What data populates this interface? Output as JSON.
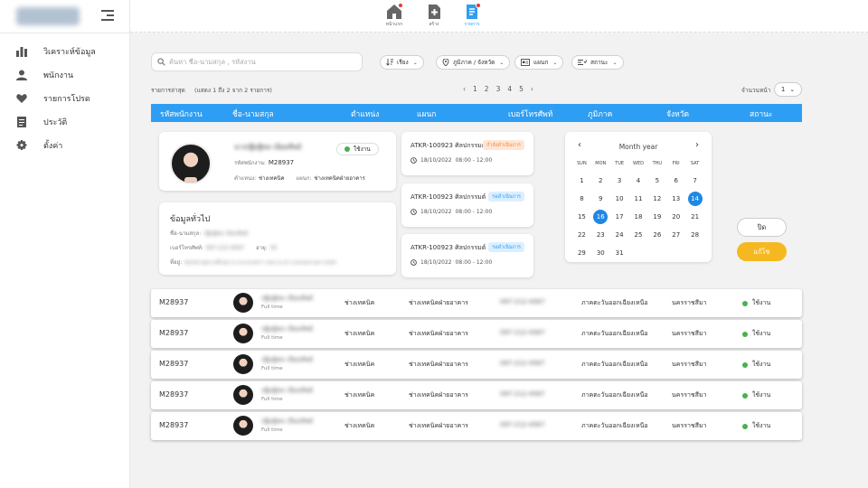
{
  "sidebar": {
    "items": [
      {
        "label": "วิเคราะห์ข้อมูล",
        "icon": "bar-chart-icon"
      },
      {
        "label": "พนักงาน",
        "icon": "person-icon"
      },
      {
        "label": "รายการโปรด",
        "icon": "heart-icon"
      },
      {
        "label": "ประวัติ",
        "icon": "document-icon"
      },
      {
        "label": "ตั้งค่า",
        "icon": "gear-icon"
      }
    ]
  },
  "topnav": {
    "items": [
      {
        "label": "หน้าแรก",
        "icon": "home-icon",
        "has_notification": true
      },
      {
        "label": "สร้าง",
        "icon": "add-document-icon",
        "has_notification": false
      },
      {
        "label": "รายการ",
        "icon": "list-document-icon",
        "has_notification": true,
        "active": true
      }
    ]
  },
  "search": {
    "placeholder": "ค้นหา ชื่อ-นามสกุล , รหัสงาน"
  },
  "filters": [
    "เรียง",
    "ภูมิภาค / จังหวัด",
    "แผนก",
    "สถานะ"
  ],
  "list": {
    "title": "รายการล่าสุด",
    "range": "(แสดง 1 ถึง 2 จาก 2 รายการ)",
    "pages": [
      "1",
      "2",
      "3",
      "4",
      "5"
    ],
    "per_page_label": "จำนวนหน้า",
    "per_page_value": "1"
  },
  "table_headers": [
    "รหัสพนักงาน",
    "ชื่อ-นามสกุล",
    "ตำแหน่ง",
    "แผนก",
    "เบอร์โทรศัพท์",
    "ภูมิภาค",
    "จังหวัด",
    "สถานะ"
  ],
  "detail": {
    "name": "นางปฐิมฐิพล เนียมทิพย์",
    "status": "ใช้งาน",
    "emp_id_label": "รหัสพนักงาน:",
    "emp_id": "M28937",
    "position_label": "ตำแหน่ง:",
    "position": "ช่างเทคนิค",
    "dept_label": "แผนก:",
    "dept": "ช่างเทคนิคฝ่ายอาคาร",
    "general_title": "ข้อมูลทั่วไป",
    "fullname_label": "ชื่อ-นามสกุล:",
    "fullname": "ปฐิมฐิพล เนียมทิพย์",
    "phone_label": "เบอร์โทรศัพท์:",
    "phone": "097-212-4567",
    "age_label": "อายุ:",
    "age": "34",
    "address_label": "ที่อยู่:",
    "address": "883/98 หมู่บ้าน ซิตี้ ซอย 12 แขวงลาดพร้าว เขตบางกะปิ จ.กรุงเทพมหานคร 10900",
    "tasks": [
      {
        "code": "ATKR-100923",
        "type": "ศิลปกรรมต์",
        "date": "18/10/2022",
        "time": "08:00 - 12:00",
        "status": "กำลังดำเนินการ",
        "status_color": "#f08a3c",
        "status_bg": "#fde6d6"
      },
      {
        "code": "ATKR-100923",
        "type": "ศิลปกรรมต์",
        "date": "18/10/2022",
        "time": "08:00 - 12:00",
        "status": "รอดำเนินการ",
        "status_color": "#2e9ef4",
        "status_bg": "#dcefff"
      },
      {
        "code": "ATKR-100923",
        "type": "ศิลปกรรมต์",
        "date": "18/10/2022",
        "time": "08:00 - 12:00",
        "status": "รอดำเนินการ",
        "status_color": "#2e9ef4",
        "status_bg": "#dcefff"
      }
    ]
  },
  "calendar": {
    "title": "Month year",
    "weekdays": [
      "SUN",
      "MON",
      "TUE",
      "WED",
      "THU",
      "FRI",
      "SAT"
    ],
    "days": [
      "1",
      "2",
      "3",
      "4",
      "5",
      "6",
      "7",
      "8",
      "9",
      "10",
      "11",
      "12",
      "13",
      "14",
      "15",
      "16",
      "17",
      "18",
      "19",
      "20",
      "21",
      "22",
      "23",
      "24",
      "25",
      "26",
      "27",
      "28",
      "29",
      "30",
      "31"
    ],
    "leading_blanks": 0,
    "selected": [
      "14",
      "16"
    ]
  },
  "buttons": {
    "close": "ปิด",
    "edit": "แก้ไข"
  },
  "rows": [
    {
      "id": "M28937",
      "name": "ปฐิมฐิพล เนียมทิพย์",
      "type": "Full time",
      "position": "ช่างเทคนิค",
      "dept": "ช่างเทคนิคฝ่ายอาคาร",
      "phone": "097-212-4567",
      "region": "ภาคตะวันออกเฉียงเหนือ",
      "province": "นครราชสีมา",
      "status": "ใช้งาน"
    },
    {
      "id": "M28937",
      "name": "ปฐิมฐิพล เนียมทิพย์",
      "type": "Full time",
      "position": "ช่างเทคนิค",
      "dept": "ช่างเทคนิคฝ่ายอาคาร",
      "phone": "097-212-4567",
      "region": "ภาคตะวันออกเฉียงเหนือ",
      "province": "นครราชสีมา",
      "status": "ใช้งาน"
    },
    {
      "id": "M28937",
      "name": "ปฐิมฐิพล เนียมทิพย์",
      "type": "Full time",
      "position": "ช่างเทคนิค",
      "dept": "ช่างเทคนิคฝ่ายอาคาร",
      "phone": "097-212-4567",
      "region": "ภาคตะวันออกเฉียงเหนือ",
      "province": "นครราชสีมา",
      "status": "ใช้งาน"
    },
    {
      "id": "M28937",
      "name": "ปฐิมฐิพล เนียมทิพย์",
      "type": "Full time",
      "position": "ช่างเทคนิค",
      "dept": "ช่างเทคนิคฝ่ายอาคาร",
      "phone": "097-212-4567",
      "region": "ภาคตะวันออกเฉียงเหนือ",
      "province": "นครราชสีมา",
      "status": "ใช้งาน"
    },
    {
      "id": "M28937",
      "name": "ปฐิมฐิพล เนียมทิพย์",
      "type": "Full time",
      "position": "ช่างเทคนิค",
      "dept": "ช่างเทคนิคฝ่ายอาคาร",
      "phone": "097-212-4567",
      "region": "ภาคตะวันออกเฉียงเหนือ",
      "province": "นครราชสีมา",
      "status": "ใช้งาน"
    }
  ],
  "colors": {
    "accent": "#2e9ef4",
    "active_status": "#4caf50",
    "edit_button": "#f5b820"
  }
}
